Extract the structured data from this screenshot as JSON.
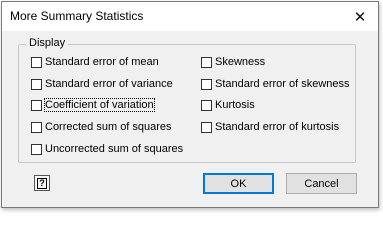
{
  "window": {
    "title": "More Summary Statistics",
    "close_glyph": "✕"
  },
  "display": {
    "legend": "Display",
    "left": [
      {
        "label": "Standard error of mean",
        "checked": false
      },
      {
        "label": "Standard error of variance",
        "checked": false
      },
      {
        "label": "Coefficient of variation",
        "checked": false
      },
      {
        "label": "Corrected sum of squares",
        "checked": false
      },
      {
        "label": "Uncorrected sum of squares",
        "checked": false
      }
    ],
    "right": [
      {
        "label": "Skewness",
        "checked": false
      },
      {
        "label": "Standard error of skewness",
        "checked": false
      },
      {
        "label": "Kurtosis",
        "checked": false
      },
      {
        "label": "Standard error of kurtosis",
        "checked": false
      }
    ]
  },
  "footer": {
    "help_glyph": "?",
    "ok_label": "OK",
    "cancel_label": "Cancel"
  }
}
